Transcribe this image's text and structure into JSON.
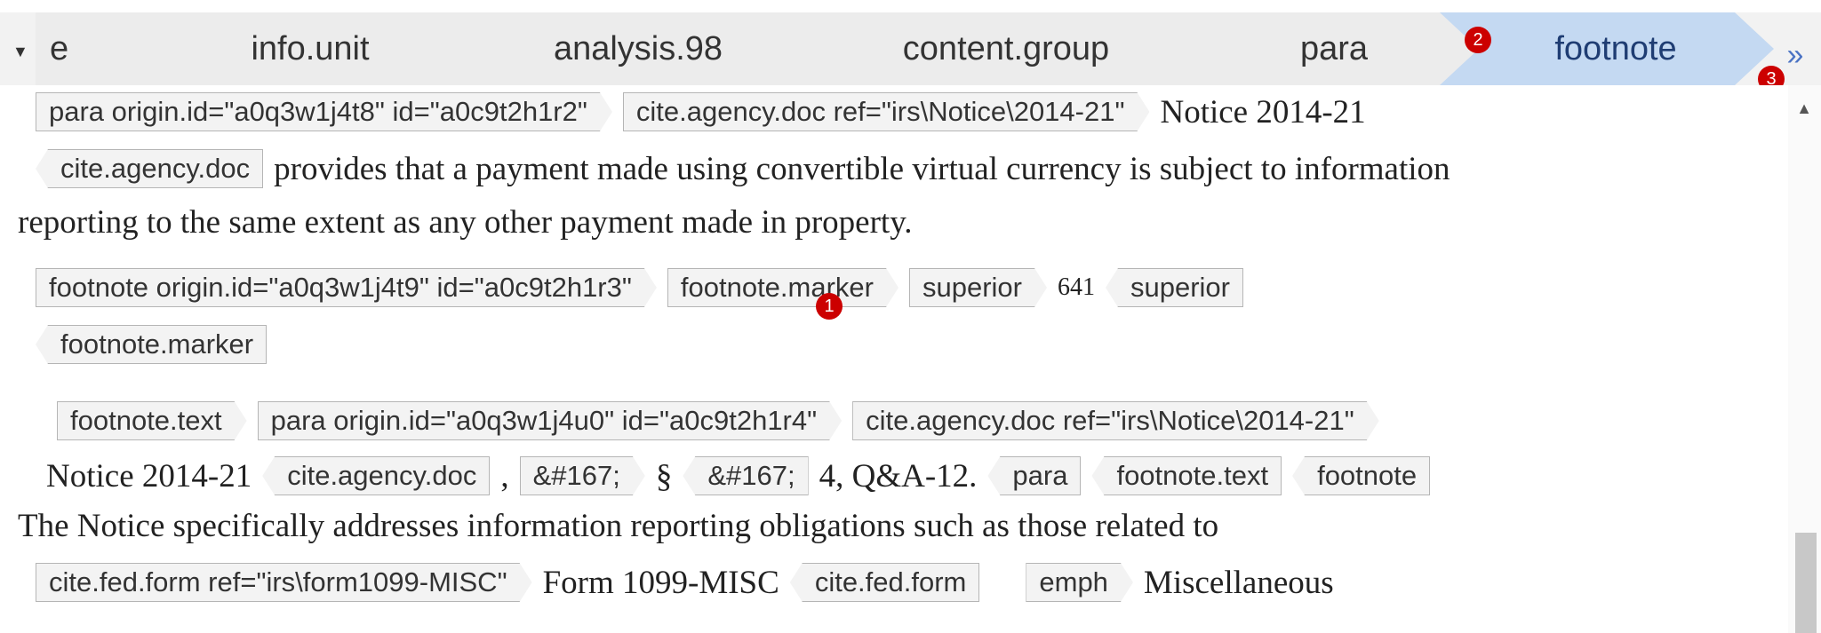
{
  "breadcrumb": {
    "items": [
      {
        "label": "e"
      },
      {
        "label": "info.unit"
      },
      {
        "label": "analysis.98"
      },
      {
        "label": "content.group"
      },
      {
        "label": "para"
      },
      {
        "label": "footnote"
      }
    ]
  },
  "badges": {
    "b1": "1",
    "b2": "2",
    "b3": "3"
  },
  "editor": {
    "l1": {
      "t1": "para origin.id=\"a0q3w1j4t8\" id=\"a0c9t2h1r2\"",
      "t2": "cite.agency.doc ref=\"irs\\Notice\\2014-21\"",
      "text": "Notice 2014-21"
    },
    "l2": {
      "t1": "cite.agency.doc",
      "text": "provides that a payment made using convertible virtual currency is subject to information"
    },
    "l3": {
      "text": "reporting to the same extent as any other payment made in property."
    },
    "l4": {
      "t1": "footnote origin.id=\"a0q3w1j4t9\" id=\"a0c9t2h1r3\"",
      "t2": "footnote.marker",
      "t3": "superior",
      "num": "641",
      "t4": "superior"
    },
    "l5": {
      "t1": "footnote.marker"
    },
    "l6": {
      "t1": "footnote.text",
      "t2": "para origin.id=\"a0q3w1j4u0\" id=\"a0c9t2h1r4\"",
      "t3": "cite.agency.doc ref=\"irs\\Notice\\2014-21\""
    },
    "l7": {
      "text1": "Notice 2014-21",
      "t1": "cite.agency.doc",
      "comma": ",",
      "t2": "&#167;",
      "sect": "§",
      "t3": "&#167;",
      "text2": "4, Q&A-12.",
      "t4": "para",
      "t5": "footnote.text",
      "t6": "footnote"
    },
    "l8": {
      "text": "The Notice specifically addresses information reporting obligations such as those related to"
    },
    "l9": {
      "t1": "cite.fed.form ref=\"irs\\form1099-MISC\"",
      "text1": "Form 1099-MISC",
      "t2": "cite.fed.form",
      "t3": "emph",
      "text2": "Miscellaneous"
    }
  }
}
